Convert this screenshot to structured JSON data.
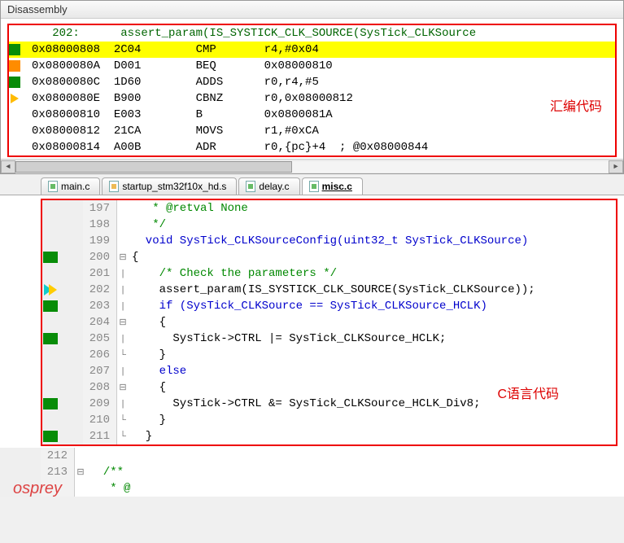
{
  "disassembly": {
    "title": "Disassembly",
    "source_line": "   202:      assert_param(IS_SYSTICK_CLK_SOURCE(SysTick_CLKSource",
    "rows": [
      {
        "bp": "green",
        "hl": true,
        "addr": "0x08000808",
        "op": "2C04",
        "mn": "CMP",
        "args": "r4,#0x04"
      },
      {
        "bp": "orange",
        "hl": false,
        "addr": "0x0800080A",
        "op": "D001",
        "mn": "BEQ",
        "args": "0x08000810"
      },
      {
        "bp": "green",
        "hl": false,
        "addr": "0x0800080C",
        "op": "1D60",
        "mn": "ADDS",
        "args": "r0,r4,#5"
      },
      {
        "bp": "arrow",
        "hl": false,
        "addr": "0x0800080E",
        "op": "B900",
        "mn": "CBNZ",
        "args": "r0,0x08000812"
      },
      {
        "bp": "",
        "hl": false,
        "addr": "0x08000810",
        "op": "E003",
        "mn": "B",
        "args": "0x0800081A"
      },
      {
        "bp": "",
        "hl": false,
        "addr": "0x08000812",
        "op": "21CA",
        "mn": "MOVS",
        "args": "r1,#0xCA"
      },
      {
        "bp": "",
        "hl": false,
        "addr": "0x08000814",
        "op": "A00B",
        "mn": "ADR",
        "args": "r0,{pc}+4  ; @0x08000844"
      }
    ],
    "annotation": "汇编代码"
  },
  "tabs": [
    "main.c",
    "startup_stm32f10x_hd.s",
    "delay.c",
    "misc.c"
  ],
  "active_tab": 3,
  "code": {
    "lines": [
      {
        "ln": 197,
        "bp": "",
        "fold": "",
        "txt": "   * @retval None",
        "cls": "comment"
      },
      {
        "ln": 198,
        "bp": "",
        "fold": "",
        "txt": "   */",
        "cls": "comment"
      },
      {
        "ln": 199,
        "bp": "",
        "fold": "",
        "txt": "  void SysTick_CLKSourceConfig(uint32_t SysTick_CLKSource)",
        "cls": "kw"
      },
      {
        "ln": 200,
        "bp": "green2",
        "fold": "⊟",
        "txt": "{",
        "cls": ""
      },
      {
        "ln": 201,
        "bp": "",
        "fold": "|",
        "txt": "    /* Check the parameters */",
        "cls": "comment"
      },
      {
        "ln": 202,
        "bp": "pc",
        "fold": "|",
        "txt": "    assert_param(IS_SYSTICK_CLK_SOURCE(SysTick_CLKSource));",
        "cls": ""
      },
      {
        "ln": 203,
        "bp": "green2",
        "fold": "|",
        "txt": "    if (SysTick_CLKSource == SysTick_CLKSource_HCLK)",
        "cls": "kw"
      },
      {
        "ln": 204,
        "bp": "",
        "fold": "⊟",
        "txt": "    {",
        "cls": ""
      },
      {
        "ln": 205,
        "bp": "green2",
        "fold": "|",
        "txt": "      SysTick->CTRL |= SysTick_CLKSource_HCLK;",
        "cls": ""
      },
      {
        "ln": 206,
        "bp": "",
        "fold": "└",
        "txt": "    }",
        "cls": ""
      },
      {
        "ln": 207,
        "bp": "",
        "fold": "|",
        "txt": "    else",
        "cls": "kw"
      },
      {
        "ln": 208,
        "bp": "",
        "fold": "⊟",
        "txt": "    {",
        "cls": ""
      },
      {
        "ln": 209,
        "bp": "green2",
        "fold": "|",
        "txt": "      SysTick->CTRL &= SysTick_CLKSource_HCLK_Div8;",
        "cls": ""
      },
      {
        "ln": 210,
        "bp": "",
        "fold": "└",
        "txt": "    }",
        "cls": ""
      },
      {
        "ln": 211,
        "bp": "green2",
        "fold": "└",
        "txt": "  }",
        "cls": ""
      }
    ],
    "trailing": [
      {
        "ln": 212,
        "txt": "",
        "cls": ""
      },
      {
        "ln": 213,
        "fold": "⊟",
        "txt": "  /**",
        "cls": "comment"
      },
      {
        "ln": "",
        "txt": "   * @",
        "cls": "comment"
      }
    ],
    "annotation": "C语言代码",
    "watermark": "osprey"
  }
}
